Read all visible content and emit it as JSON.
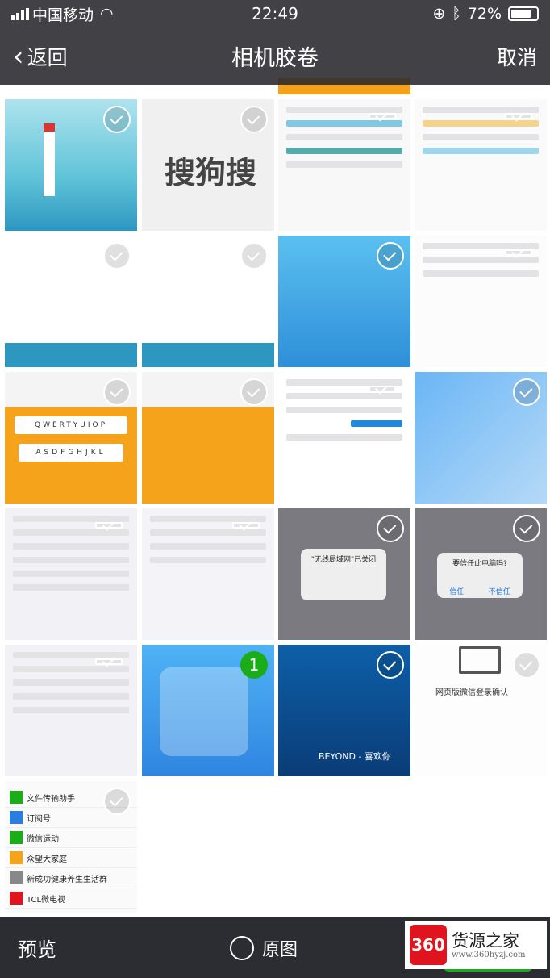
{
  "status_bar": {
    "carrier": "中国移动",
    "time": "22:49",
    "battery": "72%",
    "battery_level": 0.72,
    "icons": [
      "signal-icon",
      "wifi-icon",
      "orientation-lock-icon",
      "bluetooth-icon",
      "battery-icon"
    ]
  },
  "nav": {
    "back_label": "返回",
    "title": "相机胶卷",
    "cancel_label": "取消"
  },
  "thumbs": {
    "sogou": "搜狗搜",
    "keyboard_row1": "QWERTYUIOP",
    "keyboard_row2": "ASDFGHJKL",
    "wifi_closed": "\"无线局域网\"已关闭",
    "trust_title": "要信任此电脑吗?",
    "trust_ok": "信任",
    "trust_no": "不信任",
    "new_badge": "1",
    "music": "BEYOND - 喜欢你",
    "web_login": "网页版微信登录确认",
    "chat_items": [
      "文件传输助手",
      "订阅号",
      "微信运动",
      "众望大家庭",
      "新成功健康养生生活群",
      "TCL微电视"
    ]
  },
  "bottom": {
    "preview_label": "预览",
    "original_label": "原图"
  },
  "watermark": {
    "logo": "360",
    "name": "货源之家",
    "url": "www.360hyzj.com"
  },
  "colors": {
    "bar": "#2b2d33",
    "accent": "#1aad19",
    "keyboard": "#f5a31a",
    "watermark": "#e0141e"
  }
}
